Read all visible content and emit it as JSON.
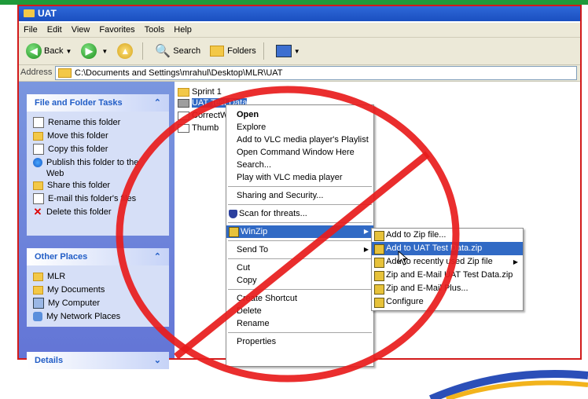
{
  "window": {
    "title": "UAT"
  },
  "menu": [
    "File",
    "Edit",
    "View",
    "Favorites",
    "Tools",
    "Help"
  ],
  "toolbar": {
    "back": "Back",
    "search": "Search",
    "folders": "Folders"
  },
  "address": {
    "label": "Address",
    "path": "C:\\Documents and Settings\\mrahul\\Desktop\\MLR\\UAT"
  },
  "tasks": {
    "title": "File and Folder Tasks",
    "items": [
      {
        "label": "Rename this folder",
        "icon": "rename-icon"
      },
      {
        "label": "Move this folder",
        "icon": "move-icon"
      },
      {
        "label": "Copy this folder",
        "icon": "copy-icon"
      },
      {
        "label": "Publish this folder to the",
        "label2": "Web",
        "icon": "publish-icon"
      },
      {
        "label": "Share this folder",
        "icon": "share-icon"
      },
      {
        "label": "E-mail this folder's files",
        "icon": "email-icon"
      },
      {
        "label": "Delete this folder",
        "icon": "delete-icon"
      }
    ]
  },
  "places": {
    "title": "Other Places",
    "items": [
      {
        "label": "MLR",
        "icon": "folder-icon"
      },
      {
        "label": "My Documents",
        "icon": "documents-icon"
      },
      {
        "label": "My Computer",
        "icon": "computer-icon"
      },
      {
        "label": "My Network Places",
        "icon": "network-icon"
      }
    ]
  },
  "details": {
    "title": "Details"
  },
  "files": [
    {
      "name": "Sprint 1"
    },
    {
      "name": "UAT Test Data"
    },
    {
      "name": "CorrectW"
    },
    {
      "name": "Thumb"
    }
  ],
  "context_menu": {
    "group1": [
      "Open",
      "Explore",
      "Add to VLC media player's Playlist",
      "Open Command Window Here",
      "Search...",
      "Play with VLC media player"
    ],
    "sharing": "Sharing and Security...",
    "scan": "Scan for threats...",
    "winzip": "WinZip",
    "sendto": "Send To",
    "group2": [
      "Cut",
      "Copy"
    ],
    "group3": [
      "Create Shortcut",
      "Delete",
      "Rename"
    ],
    "properties": "Properties"
  },
  "winzip_menu": [
    {
      "label": "Add to Zip file..."
    },
    {
      "label": "Add to UAT Test Data.zip"
    },
    {
      "label": "Add to recently used Zip file"
    },
    {
      "label": "Zip and E-Mail UAT Test Data.zip"
    },
    {
      "label": "Zip and E-Mail Plus..."
    },
    {
      "label": "Configure"
    }
  ],
  "colors": {
    "no_sign": "#e81c1c",
    "frame": "#d21b1b",
    "highlight": "#316ac5",
    "title": "#1a4fc0"
  }
}
